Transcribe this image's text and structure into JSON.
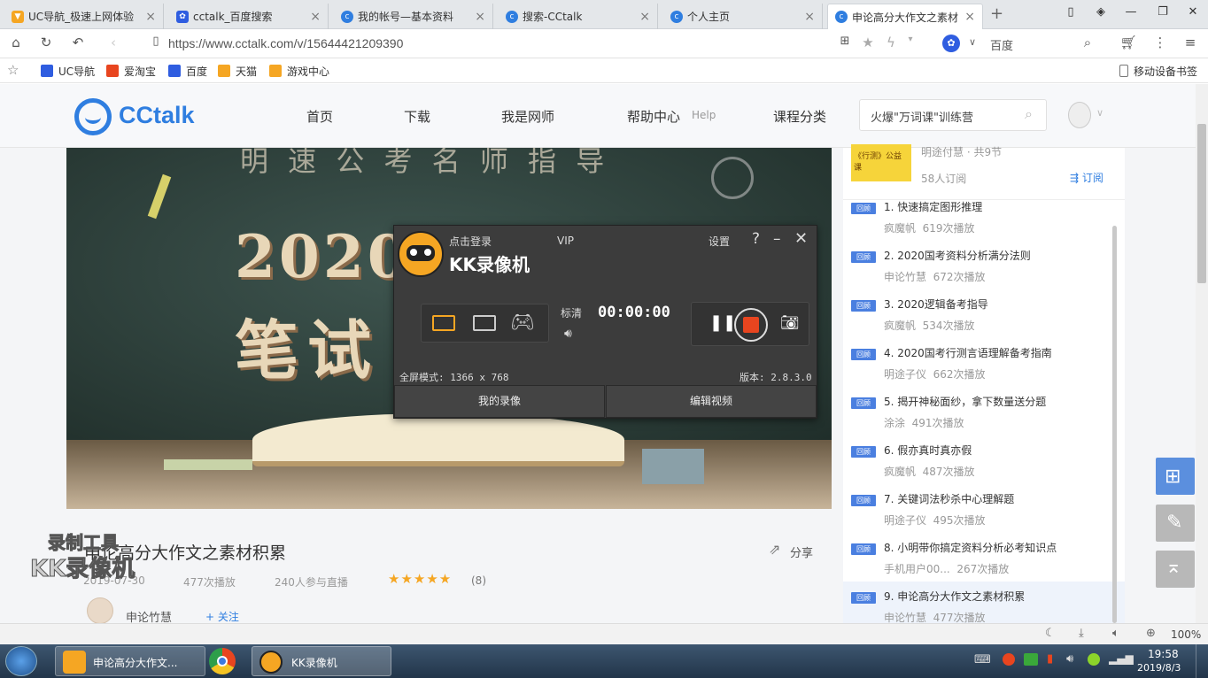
{
  "browser": {
    "tabs": [
      {
        "title": "UC导航_极速上网体验",
        "active": false
      },
      {
        "title": "cctalk_百度搜索",
        "active": false
      },
      {
        "title": "我的帐号—基本资料",
        "active": false
      },
      {
        "title": "搜索-CCtalk",
        "active": false
      },
      {
        "title": "个人主页",
        "active": false
      },
      {
        "title": "申论高分大作文之素材",
        "active": true
      }
    ],
    "url": "https://www.cctalk.com/v/15644421209390",
    "search_engine": "百度",
    "bookmarks": [
      "UC导航",
      "爱淘宝",
      "百度",
      "天猫",
      "游戏中心"
    ],
    "mobile_bookmarks": "移动设备书签"
  },
  "site": {
    "logo": "CCtalk",
    "nav": [
      "首页",
      "下载",
      "我是网师",
      "帮助中心",
      "课程分类"
    ],
    "help_suffix": "Help",
    "search_placeholder": "火爆\"万词课\"训练营"
  },
  "video": {
    "board_top": "明 速 公 考   名 师 指 导",
    "board_year": "2020年国考",
    "board_exam": "笔试"
  },
  "course": {
    "title": "申论高分大作文之素材积累",
    "date": "2019-07-30",
    "plays": "477次播放",
    "live": "240人参与直播",
    "rating_count": "(8)",
    "rating": 5,
    "share": "分享",
    "teacher": "申论竹慧",
    "follow": "+ 关注"
  },
  "sidebar": {
    "top_meta": "明途付慧 · 共9节",
    "subscribers": "58人订阅",
    "subscribe": "订阅",
    "cover_text": "《行测》公益课",
    "tag": "回顾",
    "lessons": [
      {
        "title": "1. 快速搞定图形推理",
        "teacher": "疯魔帆",
        "plays": "619次播放"
      },
      {
        "title": "2. 2020国考资料分析满分法则",
        "teacher": "申论竹慧",
        "plays": "672次播放"
      },
      {
        "title": "3. 2020逻辑备考指导",
        "teacher": "疯魔帆",
        "plays": "534次播放"
      },
      {
        "title": "4. 2020国考行测言语理解备考指南",
        "teacher": "明途子仪",
        "plays": "662次播放"
      },
      {
        "title": "5. 揭开神秘面纱，拿下数量送分题",
        "teacher": "涂涂",
        "plays": "491次播放"
      },
      {
        "title": "6. 假亦真时真亦假",
        "teacher": "疯魔帆",
        "plays": "487次播放"
      },
      {
        "title": "7. 关键词法秒杀中心理解题",
        "teacher": "明途子仪",
        "plays": "495次播放"
      },
      {
        "title": "8. 小明带你搞定资料分析必考知识点",
        "teacher": "手机用户00...",
        "plays": "267次播放"
      },
      {
        "title": "9. 申论高分大作文之素材积累",
        "teacher": "申论竹慧",
        "plays": "477次播放"
      }
    ]
  },
  "kk": {
    "login": "点击登录",
    "vip": "VIP",
    "settings": "设置",
    "help": "?",
    "name": "KK录像机",
    "quality": "标清",
    "timer": "00:00:00",
    "mode": "全屏模式: 1366 x 768",
    "version": "版本: 2.8.3.0",
    "my_videos": "我的录像",
    "edit_video": "编辑视频"
  },
  "watermark": {
    "line1": "录制工具",
    "line2": "KK录像机"
  },
  "status": {
    "zoom": "100%"
  },
  "taskbar": {
    "items": [
      "申论高分大作文...",
      "KK录像机"
    ],
    "time": "19:58",
    "date": "2019/8/3"
  },
  "colors": {
    "accent": "#2f7ee0",
    "tag": "#4a7fe0",
    "star": "#f5a623",
    "record": "#e8451f"
  }
}
